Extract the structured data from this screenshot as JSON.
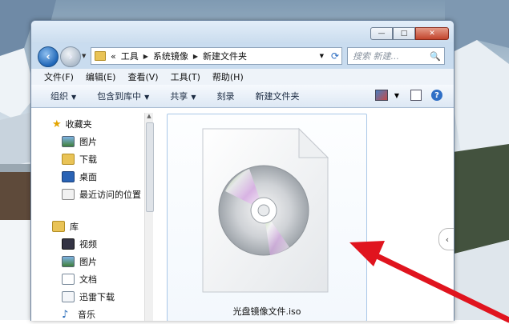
{
  "window": {
    "controls": {
      "minimize": "—",
      "maximize": "□",
      "close": "✕"
    }
  },
  "address": {
    "prefix": "«",
    "crumbs": [
      "工具",
      "系统镜像",
      "新建文件夹"
    ],
    "search_placeholder": "搜索 新建..."
  },
  "menu": [
    "文件(F)",
    "编辑(E)",
    "查看(V)",
    "工具(T)",
    "帮助(H)"
  ],
  "toolbar": [
    "组织",
    "包含到库中",
    "共享",
    "刻录",
    "新建文件夹"
  ],
  "nav": {
    "favorites": {
      "label": "收藏夹",
      "items": [
        "图片",
        "下载",
        "桌面",
        "最近访问的位置"
      ]
    },
    "libraries": {
      "label": "库",
      "items": [
        "视频",
        "图片",
        "文档",
        "迅雷下载",
        "音乐"
      ]
    }
  },
  "file": {
    "name": "光盘镜像文件.iso"
  },
  "colors": {
    "accent": "#1f66b7",
    "arrow": "#e0141e"
  }
}
